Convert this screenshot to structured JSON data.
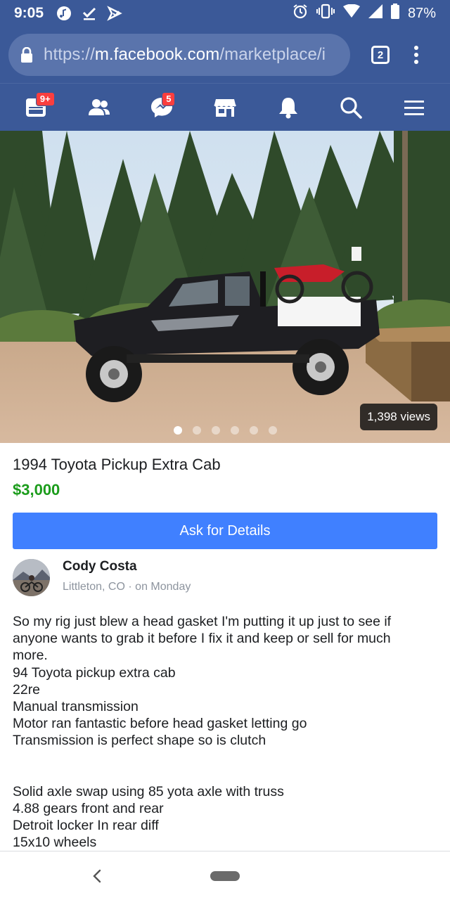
{
  "status_bar": {
    "time": "9:05",
    "battery": "87%"
  },
  "browser": {
    "url_scheme": "https://",
    "url_host": "m.facebook.com",
    "url_path": "/marketplace/i",
    "tab_count": "2"
  },
  "fb_nav": {
    "items": [
      {
        "name": "feed",
        "badge": "9+"
      },
      {
        "name": "friends",
        "badge": ""
      },
      {
        "name": "messenger",
        "badge": "5"
      },
      {
        "name": "marketplace",
        "badge": ""
      },
      {
        "name": "notifications",
        "badge": ""
      },
      {
        "name": "search",
        "badge": ""
      },
      {
        "name": "menu",
        "badge": ""
      }
    ]
  },
  "photo": {
    "views": "1,398 views",
    "page_count": 6,
    "active_index": 0
  },
  "listing": {
    "title": "1994 Toyota Pickup Extra Cab",
    "price": "$3,000",
    "ask_button": "Ask for Details",
    "seller_name": "Cody Costa",
    "location": "Littleton, CO",
    "separator": "·",
    "posted": "on Monday",
    "description_block1": [
      "So my rig just blew a head gasket I'm putting it up just to see if",
      "anyone wants to grab it before I fix it and keep or sell for much",
      "more.",
      "94 Toyota pickup extra cab",
      "22re",
      "Manual transmission",
      "Motor ran fantastic before head gasket letting go",
      "Transmission is perfect shape so is clutch"
    ],
    "description_block2": [
      "Solid axle swap using 85 yota axle with truss",
      "4.88 gears front and rear",
      "Detroit locker In rear diff",
      "15x10 wheels"
    ]
  },
  "colors": {
    "facebook_blue": "#3b5998",
    "button_blue": "#4080ff",
    "price_green": "#1b9c1b",
    "badge_red": "#fa3e3e"
  }
}
